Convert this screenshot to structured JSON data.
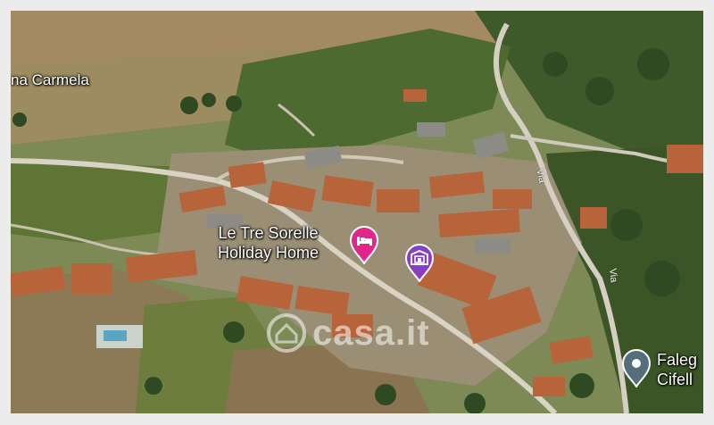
{
  "map": {
    "place_labels": [
      {
        "text": "na Carmela"
      }
    ],
    "poi_markers": [
      {
        "label_line1": "Le Tre Sorelle",
        "label_line2": "Holiday Home",
        "icon": "hotel-bed-icon",
        "color": "#e2258b"
      },
      {
        "icon": "building-icon",
        "color": "#8a3fc1"
      },
      {
        "label_line1": "Faleg",
        "label_line2": "Cifell",
        "icon": "location-pin-icon",
        "color": "#546e7a"
      }
    ],
    "road_labels": [
      "Via",
      "Via"
    ],
    "watermark": {
      "text": "casa.it"
    }
  }
}
